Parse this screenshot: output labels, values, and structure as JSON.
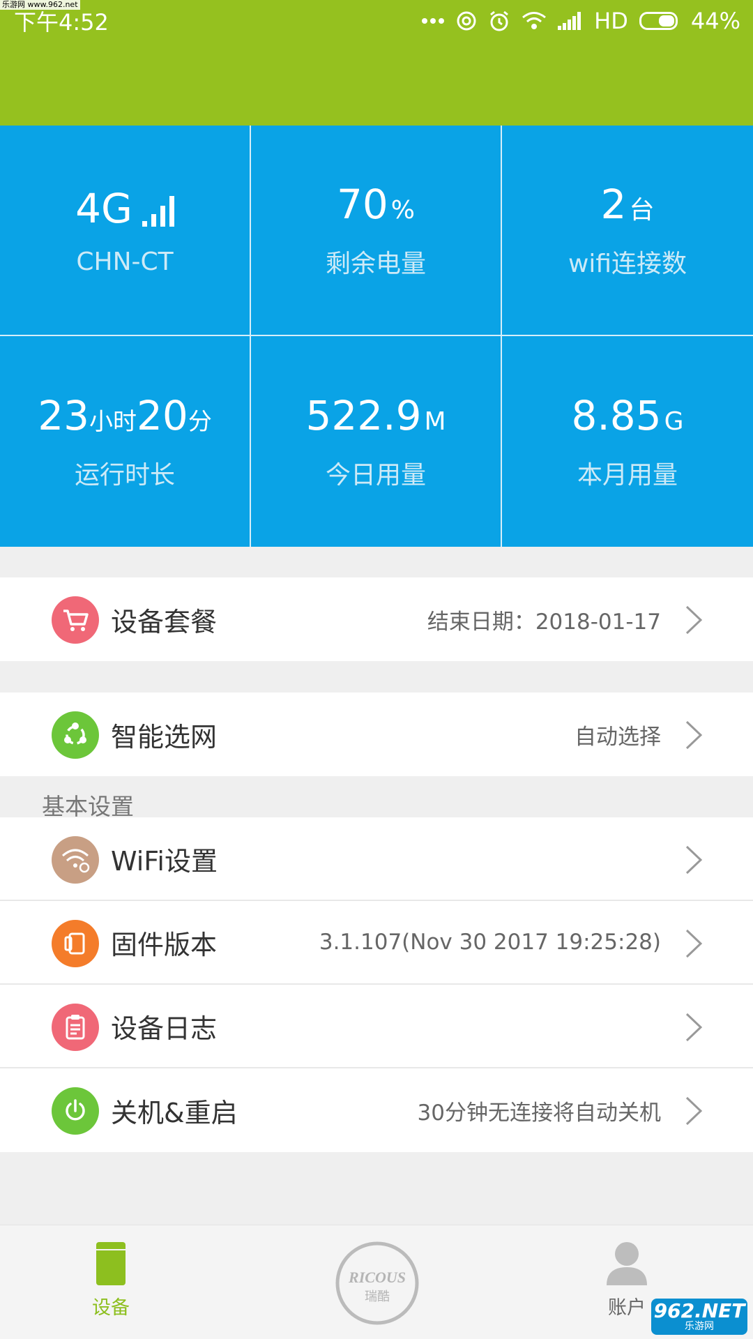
{
  "status_bar": {
    "watermark": "乐游网 www.962.net",
    "time": "下午4:52",
    "network": "HD",
    "battery": "44%"
  },
  "stats": [
    {
      "value": "4G",
      "unit": "",
      "label": "CHN-CT"
    },
    {
      "value": "70",
      "unit": "%",
      "label": "剩余电量"
    },
    {
      "value": "2",
      "unit": "台",
      "label": "wifi连接数"
    },
    {
      "value_hours": "23",
      "unit_hours": "小时",
      "value_minutes": "20",
      "unit_minutes": "分",
      "label": "运行时长"
    },
    {
      "value": "522.9",
      "unit": "M",
      "label": "今日用量"
    },
    {
      "value": "8.85",
      "unit": "G",
      "label": "本月用量"
    }
  ],
  "rows": {
    "package": {
      "title": "设备套餐",
      "value": "结束日期：2018-01-17"
    },
    "network_select": {
      "title": "智能选网",
      "value": "自动选择"
    },
    "section_label": "基本设置",
    "wifi": {
      "title": "WiFi设置",
      "value": ""
    },
    "firmware": {
      "title": "固件版本",
      "value": "3.1.107(Nov 30 2017 19:25:28)"
    },
    "log": {
      "title": "设备日志",
      "value": ""
    },
    "power": {
      "title": "关机&重启",
      "value": "30分钟无连接将自动关机"
    }
  },
  "tabbar": {
    "device": "设备",
    "logo_text": "RICOUS",
    "logo_sub": "瑞酷",
    "account": "账户"
  },
  "watermark_bottom": {
    "line1": "962.NET",
    "line2": "乐游网"
  },
  "colors": {
    "header_green": "#95c11f",
    "stats_blue": "#0aa3e6",
    "tab_active": "#8dbf1f"
  }
}
